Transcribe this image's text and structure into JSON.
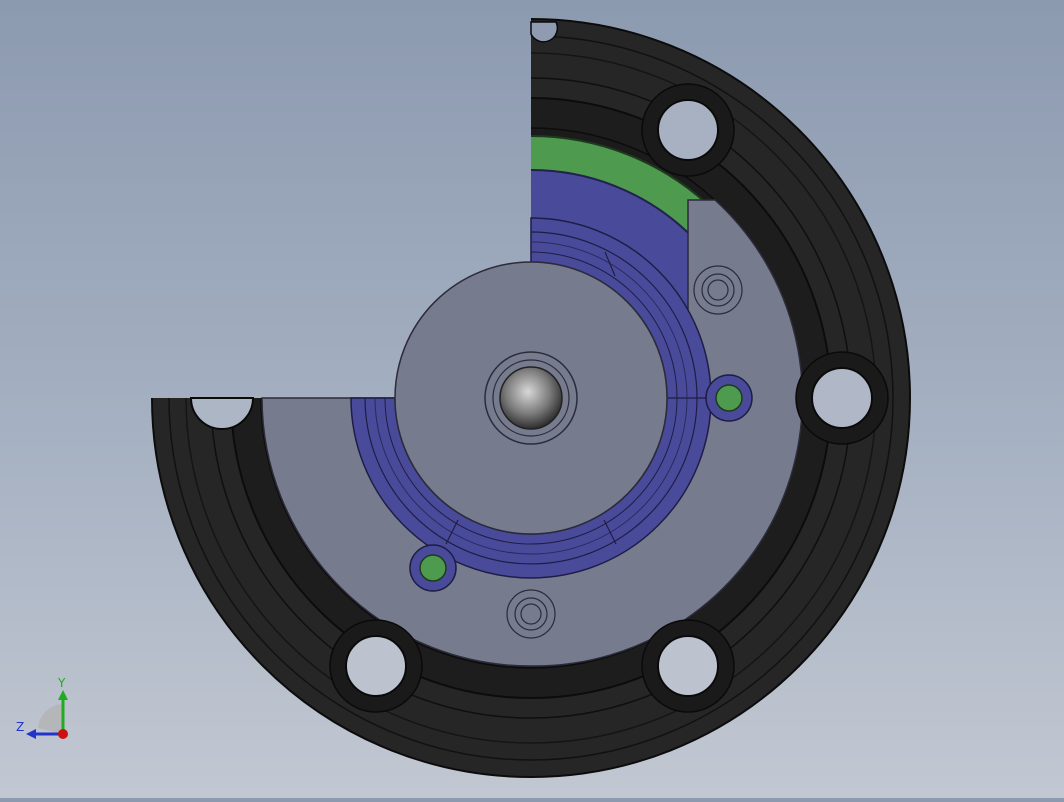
{
  "scene": {
    "colors": {
      "background_top": "#8c9ab0",
      "background_bottom": "#c2c8d2",
      "outer_ring": "#2a2a2a",
      "outer_ring_edge": "#0e0e0e",
      "base_plate": "#777b8e",
      "blue_part": "#4a4a9a",
      "green_part": "#4e9a4e",
      "shaft": "#8a8a8a"
    }
  },
  "triad": {
    "y_label": "Y",
    "z_label": "Z",
    "y_color": "#22aa22",
    "z_color": "#2233cc",
    "x_color": "#cc1111"
  }
}
